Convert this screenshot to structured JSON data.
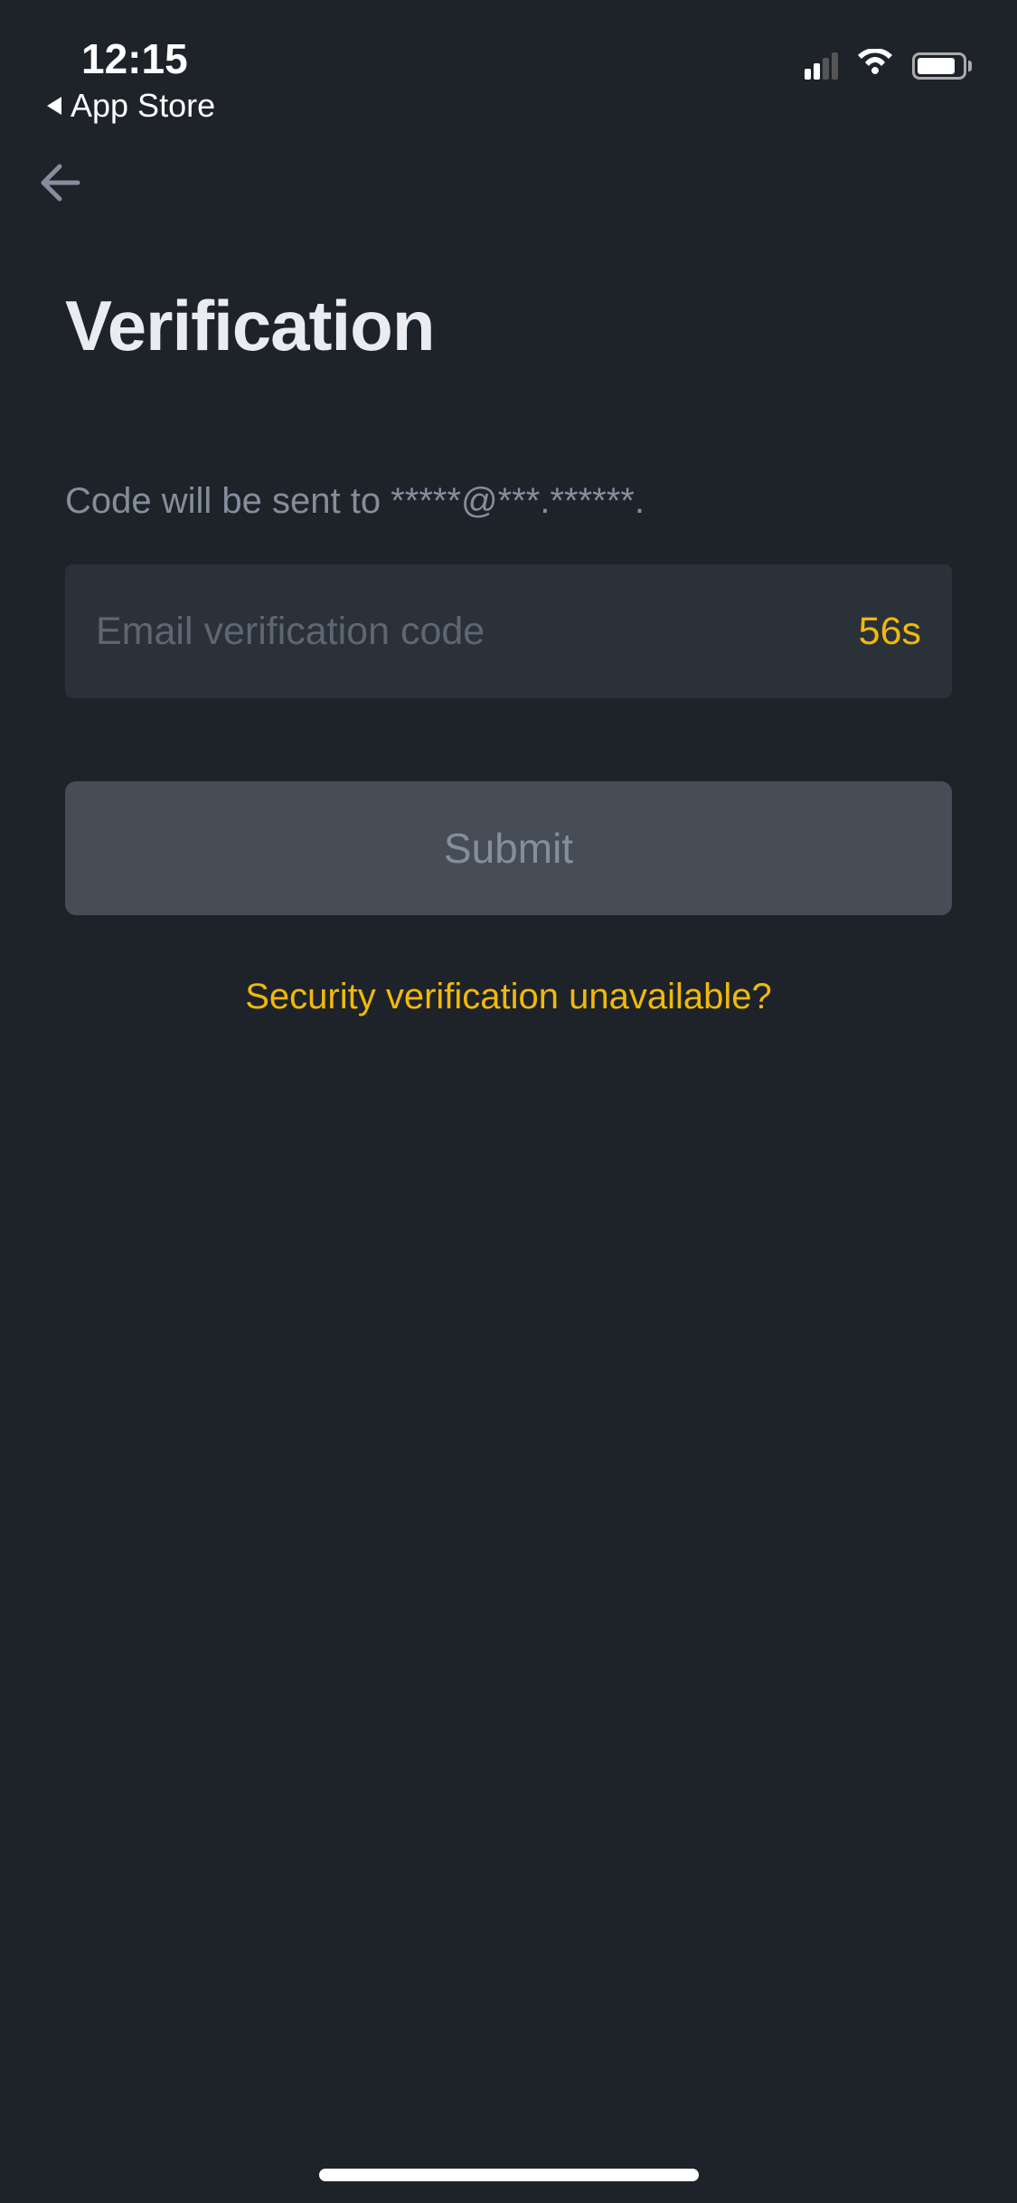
{
  "status_bar": {
    "time": "12:15",
    "back_to_app_label": "App Store"
  },
  "page": {
    "title": "Verification",
    "info_text": "Code will be sent to *****@***.******.",
    "input_placeholder": "Email verification code",
    "countdown": "56s",
    "submit_label": "Submit",
    "help_link_label": "Security verification unavailable?"
  },
  "colors": {
    "background": "#1e2329",
    "accent": "#f0b90b",
    "input_bg": "#2b3139",
    "button_bg": "#474d57",
    "text_secondary": "#848e9c",
    "text_muted": "#5e6673"
  }
}
